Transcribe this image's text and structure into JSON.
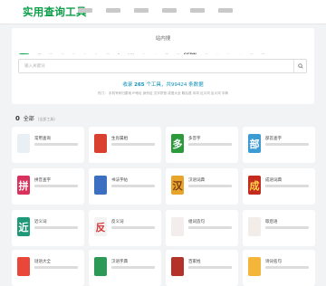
{
  "header": {
    "logo": "实用查询工具"
  },
  "search": {
    "title": "站内搜",
    "placeholder": "输入关键词",
    "engines": [
      {
        "label": "站",
        "color": "#0c9f4a",
        "active": true
      },
      {
        "label": "百",
        "color": "#2f6ee8"
      },
      {
        "label": "微",
        "color": "#2fae5a"
      },
      {
        "label": "知",
        "color": "#1d8ae6"
      },
      {
        "label": "谷",
        "color": "#e8a22f"
      },
      {
        "label": "必",
        "color": "#3d9fd6"
      },
      {
        "label": "头",
        "color": "#d7463c"
      },
      {
        "label": "搜",
        "color": "#e3753a"
      },
      {
        "label": "B",
        "color": "#e7558c"
      },
      {
        "label": "360",
        "color": "#2db36c"
      },
      {
        "label": "淘",
        "color": "#ef6b1f"
      },
      {
        "label": "京",
        "color": "#d52b2b"
      },
      {
        "label": "豆",
        "color": "#35a048"
      },
      {
        "label": "微",
        "color": "#e24d3b"
      },
      {
        "label": "CSDN",
        "color": "#d0342c",
        "csdn": true
      },
      {
        "label": "知",
        "color": "#0d7be4"
      },
      {
        "label": "抖",
        "color": "#222222"
      },
      {
        "label": "快",
        "color": "#f07a1d"
      },
      {
        "label": "小",
        "color": "#4a86e8"
      },
      {
        "label": "秘",
        "color": "#3a6bd8"
      },
      {
        "label": "JS",
        "color": "#f0b429"
      }
    ],
    "stats_prefix": "收录",
    "stats_tools": "265",
    "stats_middle": "个工具，共99424",
    "stats_suffix": "条数据",
    "tags": "热门： 手机号码归属地 IP地址 身份证 汉字拼音 成语大全 歇后语 诗词 近义词 反义词 字典"
  },
  "section": {
    "count": "0",
    "title": "全部",
    "sub": "(全部工具)"
  },
  "cards": [
    {
      "title": "常用查询",
      "icon": "",
      "color": "#e8f0f6",
      "fg": "#5aa6d8"
    },
    {
      "title": "生肖属相",
      "icon": "",
      "color": "#d9402f",
      "fg": "#ffffff"
    },
    {
      "title": "多音字",
      "icon": "多",
      "color": "#2c9a3a",
      "fg": "#ffffff"
    },
    {
      "title": "部首查字",
      "icon": "部",
      "color": "#3d9bd3",
      "fg": "#ffffff"
    },
    {
      "title": "拼音查字",
      "icon": "拼",
      "color": "#d8325c",
      "fg": "#ffffff"
    },
    {
      "title": "书法字帖",
      "icon": "",
      "color": "#3c6fc2",
      "fg": "#ffffff"
    },
    {
      "title": "汉语词典",
      "icon": "汉",
      "color": "#e7a52b",
      "fg": "#7a3a12"
    },
    {
      "title": "成语词典",
      "icon": "成",
      "color": "#c42b1f",
      "fg": "#ffd34a"
    },
    {
      "title": "近义词",
      "icon": "近",
      "color": "#1f9a78",
      "fg": "#ffffff"
    },
    {
      "title": "反义词",
      "icon": "反",
      "color": "#f3f3f3",
      "fg": "#d73b3b"
    },
    {
      "title": "组词造句",
      "icon": "",
      "color": "#f4eded",
      "fg": "#d44c4c"
    },
    {
      "title": "歇后语",
      "icon": "",
      "color": "#f2ede8",
      "fg": "#c33e2b"
    },
    {
      "title": "谜语大全",
      "icon": "",
      "color": "#e8473a",
      "fg": "#ffffff"
    },
    {
      "title": "汉语字典",
      "icon": "",
      "color": "#2c9a56",
      "fg": "#ffffff"
    },
    {
      "title": "百家姓",
      "icon": "",
      "color": "#b3332a",
      "fg": "#ffd34a"
    },
    {
      "title": "诗词名句",
      "icon": "",
      "color": "#f4b63a",
      "fg": "#c93a2a"
    }
  ]
}
